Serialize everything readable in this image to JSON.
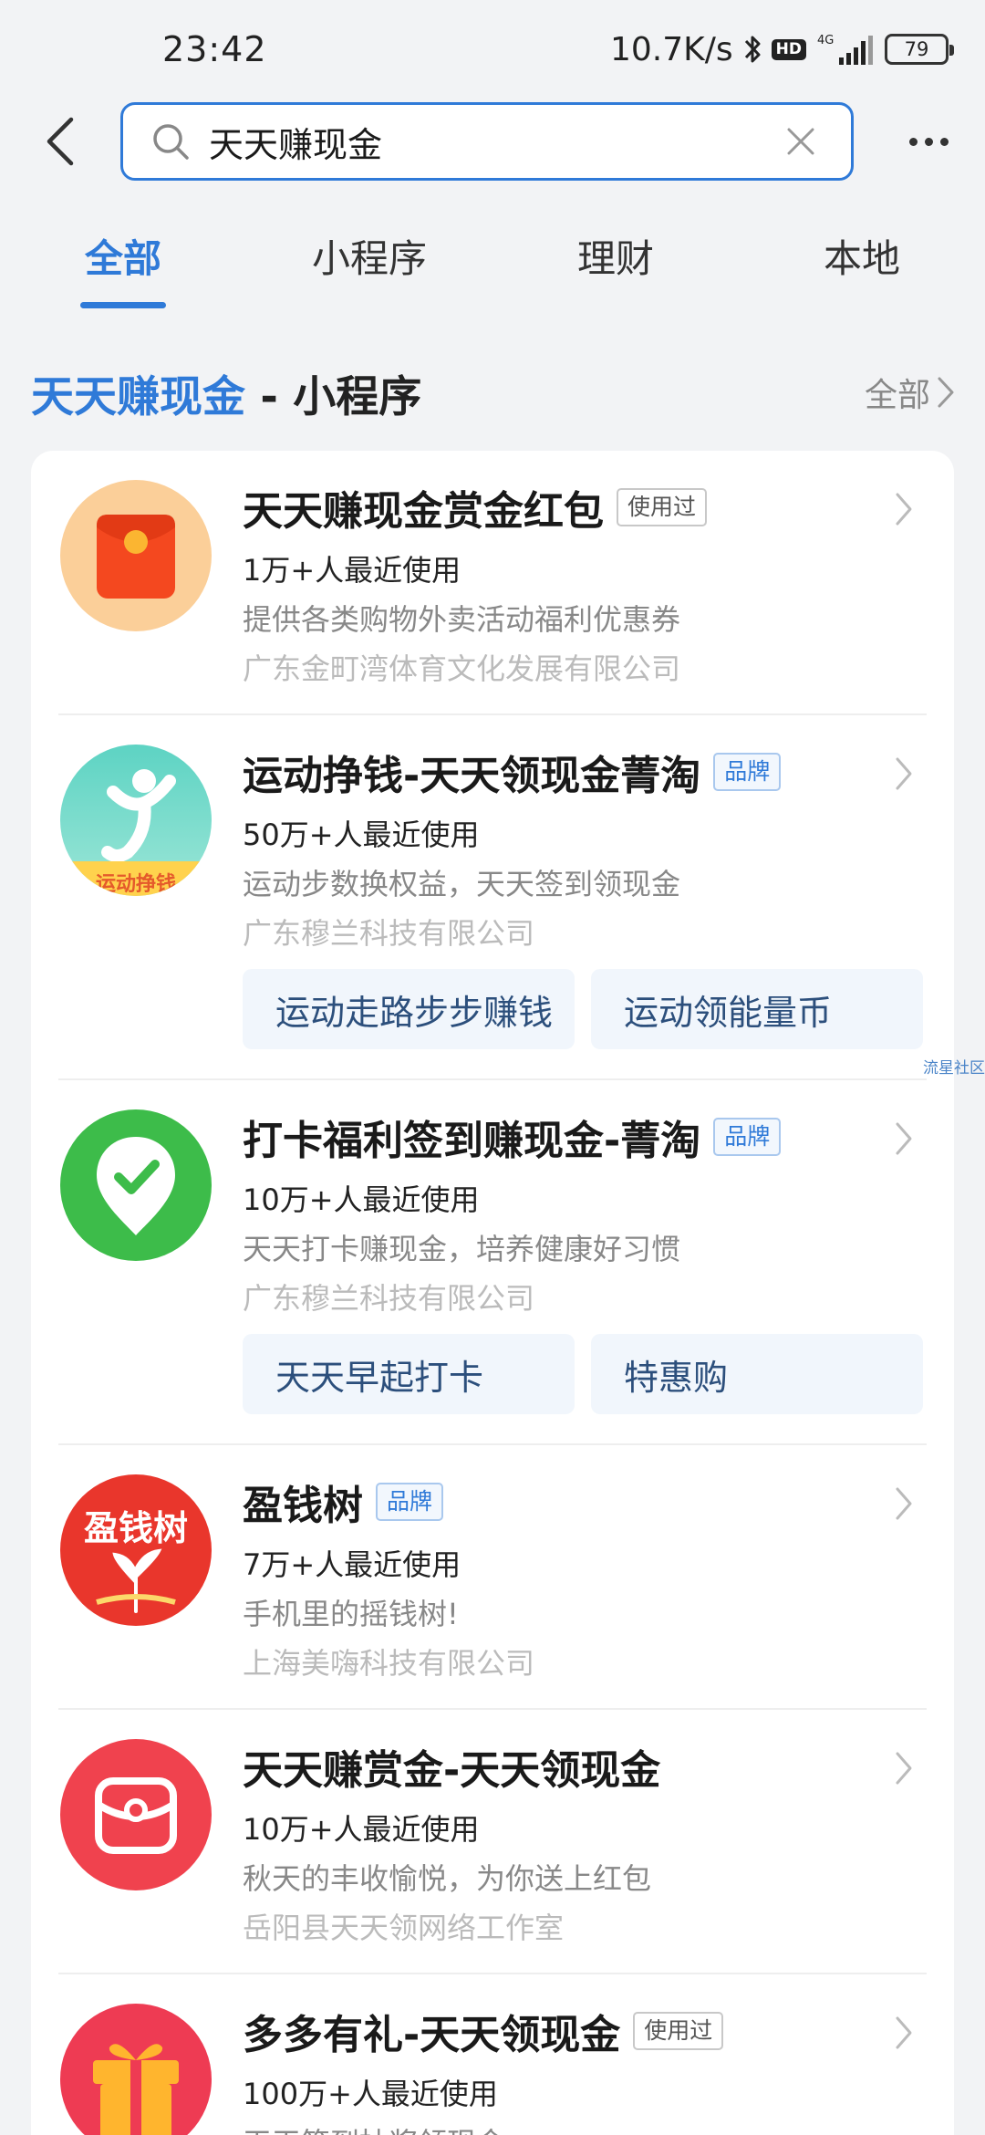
{
  "status_bar": {
    "time": "23:42",
    "net_speed": "10.7K/s",
    "network": "4G",
    "battery": "79"
  },
  "search": {
    "query": "天天赚现金"
  },
  "tabs": [
    {
      "label": "全部",
      "active": true
    },
    {
      "label": "小程序",
      "active": false
    },
    {
      "label": "理财",
      "active": false
    },
    {
      "label": "本地",
      "active": false
    }
  ],
  "section": {
    "highlight": "天天赚现金",
    "suffix": " - 小程序",
    "all_label": "全部"
  },
  "results": [
    {
      "name": "天天赚现金赏金红包",
      "badge": "使用过",
      "users": "1万+人最近使用",
      "desc": "提供各类购物外卖活动福利优惠券",
      "company": "广东金町湾体育文化发展有限公司",
      "icon": "red-envelope-icon"
    },
    {
      "name": "运动挣钱-天天领现金菁淘",
      "badge": "品牌",
      "users": "50万+人最近使用",
      "desc": "运动步数换权益，天天签到领现金",
      "company": "广东穆兰科技有限公司",
      "icon": "running-person-icon",
      "icon_text": "运动挣钱",
      "actions": [
        "运动走路步步赚钱",
        "运动领能量币"
      ]
    },
    {
      "name": "打卡福利签到赚现金-菁淘",
      "badge": "品牌",
      "users": "10万+人最近使用",
      "desc": "天天打卡赚现金，培养健康好习惯",
      "company": "广东穆兰科技有限公司",
      "icon": "check-pin-icon",
      "actions": [
        "天天早起打卡",
        "特惠购"
      ]
    },
    {
      "name": "盈钱树",
      "badge": "品牌",
      "users": "7万+人最近使用",
      "desc": "手机里的摇钱树!",
      "company": "上海美嗨科技有限公司",
      "icon": "money-tree-icon",
      "icon_text": "盈钱树"
    },
    {
      "name": "天天赚赏金-天天领现金",
      "badge": "",
      "users": "10万+人最近使用",
      "desc": "秋天的丰收愉悦，为你送上红包",
      "company": "岳阳县天天领网络工作室",
      "icon": "wallet-icon"
    },
    {
      "name": "多多有礼-天天领现金",
      "badge": "使用过",
      "users": "100万+人最近使用",
      "desc": "天天签到抽奖领现金",
      "company": "",
      "icon": "gift-icon"
    }
  ],
  "side_text": "流星社区",
  "colors": {
    "accent": "#2f7ad8",
    "background": "#f2f3f5"
  }
}
